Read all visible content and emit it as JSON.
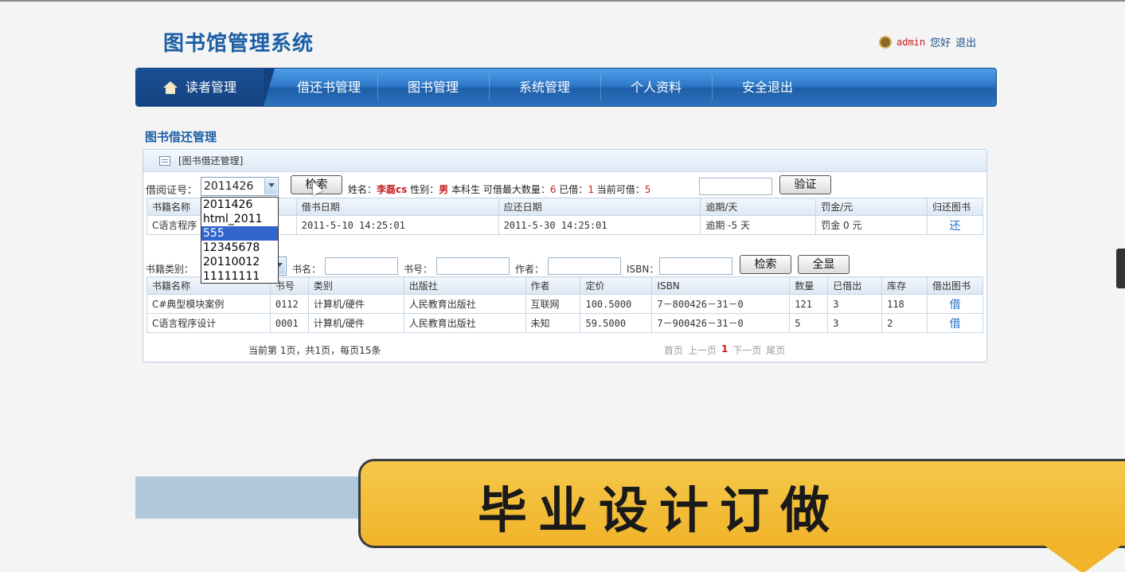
{
  "app": {
    "title": "图书馆管理系统"
  },
  "user": {
    "name": "admin",
    "greeting": "您好",
    "logout": "退出"
  },
  "nav": [
    "读者管理",
    "借还书管理",
    "图书管理",
    "系统管理",
    "个人资料",
    "安全退出"
  ],
  "section_title": "图书借还管理",
  "panel_title": "[图书借还管理]",
  "reader": {
    "card_label": "借阅证号：",
    "card_value": "2011426",
    "search_btn": "检索",
    "name_label": "姓名：",
    "name_value": "李磊cs",
    "gender_label": "性别：",
    "gender_value": "男",
    "type": "本科生",
    "max_label": "可借最大数量：",
    "max_value": "6",
    "borrowed_label": "已借：",
    "borrowed_value": "1",
    "can_label": "当前可借：",
    "can_value": "5",
    "verify_btn": "验证"
  },
  "dropdown_options": [
    "2011426",
    "html_2011",
    "555",
    "12345678",
    "20110012",
    "11111111"
  ],
  "dropdown_selected_index": 2,
  "borrow_table": {
    "headers": [
      "书籍名称",
      "借书日期",
      "应还日期",
      "逾期/天",
      "罚金/元",
      "归还图书"
    ],
    "rows": [
      [
        "C语言程序",
        "2011-5-10 14:25:01",
        "2011-5-30 14:25:01",
        "逾期 -5 天",
        "罚金 0 元",
        "还"
      ]
    ]
  },
  "search": {
    "category_label": "书籍类别：",
    "bookname_label": "书名：",
    "bookno_label": "书号：",
    "author_label": "作者：",
    "isbn_label": "ISBN：",
    "search_btn": "检索",
    "showall_btn": "全显"
  },
  "book_table": {
    "headers": [
      "书籍名称",
      "书号",
      "类别",
      "出版社",
      "作者",
      "定价",
      "ISBN",
      "数量",
      "已借出",
      "库存",
      "借出图书"
    ],
    "rows": [
      [
        "C#典型模块案例",
        "0112",
        "计算机/硬件",
        "人民教育出版社",
        "互联网",
        "100.5000",
        "7－800426－31－0",
        "121",
        "3",
        "118",
        "借"
      ],
      [
        "C语言程序设计",
        "0001",
        "计算机/硬件",
        "人民教育出版社",
        "未知",
        "59.5000",
        "7－900426－31－0",
        "5",
        "3",
        "2",
        "借"
      ]
    ]
  },
  "pager": {
    "info": "当前第 1页，共1页，每页15条",
    "first": "首页",
    "prev": "上一页",
    "current": "1",
    "next": "下一页",
    "last": "尾页"
  },
  "banner_text": "毕业设计订做",
  "colors": {
    "nav_blue": "#2f79c9",
    "title_blue": "#1d5fa6",
    "accent_red": "#c41e1e",
    "banner_yellow": "#f1b42a"
  }
}
